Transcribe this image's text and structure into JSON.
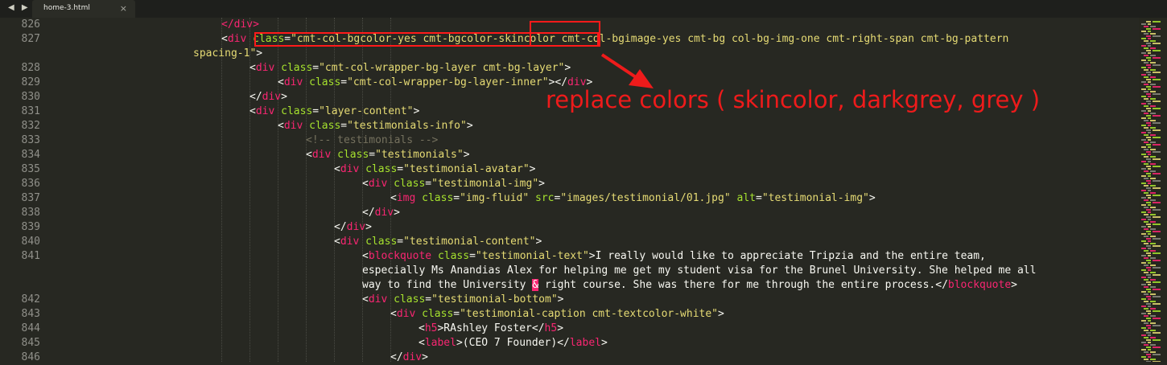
{
  "tabbar": {
    "nav": "◀ ▶",
    "tab_title": "home-3.html",
    "tab_close": "×"
  },
  "lines": [
    {
      "no": "826",
      "indent": 1,
      "segs": [
        [
          "t",
          "</div>"
        ]
      ]
    },
    {
      "no": "827",
      "indent": 1,
      "segs": [
        [
          "p",
          "<"
        ],
        [
          "t",
          "div"
        ],
        [
          "p",
          " "
        ],
        [
          "a",
          "class"
        ],
        [
          "p",
          "="
        ],
        [
          "s",
          "\"cmt-col-bgcolor-yes cmt-bgcolor-skincolor cmt-col-bgimage-yes cmt-bg col-bg-img-one cmt-right-span cmt-bg-pattern"
        ]
      ]
    },
    {
      "no": "",
      "indent": 0,
      "segs": [
        [
          "s",
          "spacing-1\""
        ],
        [
          "p",
          ">"
        ]
      ]
    },
    {
      "no": "828",
      "indent": 2,
      "segs": [
        [
          "p",
          "<"
        ],
        [
          "t",
          "div"
        ],
        [
          "p",
          " "
        ],
        [
          "a",
          "class"
        ],
        [
          "p",
          "="
        ],
        [
          "s",
          "\"cmt-col-wrapper-bg-layer cmt-bg-layer\""
        ],
        [
          "p",
          ">"
        ]
      ]
    },
    {
      "no": "829",
      "indent": 3,
      "segs": [
        [
          "p",
          "<"
        ],
        [
          "t",
          "div"
        ],
        [
          "p",
          " "
        ],
        [
          "a",
          "class"
        ],
        [
          "p",
          "="
        ],
        [
          "s",
          "\"cmt-col-wrapper-bg-layer-inner\""
        ],
        [
          "p",
          "></"
        ],
        [
          "t",
          "div"
        ],
        [
          "p",
          ">"
        ]
      ]
    },
    {
      "no": "830",
      "indent": 2,
      "segs": [
        [
          "p",
          "</"
        ],
        [
          "t",
          "div"
        ],
        [
          "p",
          ">"
        ]
      ]
    },
    {
      "no": "831",
      "indent": 2,
      "segs": [
        [
          "p",
          "<"
        ],
        [
          "t",
          "div"
        ],
        [
          "p",
          " "
        ],
        [
          "a",
          "class"
        ],
        [
          "p",
          "="
        ],
        [
          "s",
          "\"layer-content\""
        ],
        [
          "p",
          ">"
        ]
      ]
    },
    {
      "no": "832",
      "indent": 3,
      "segs": [
        [
          "p",
          "<"
        ],
        [
          "t",
          "div"
        ],
        [
          "p",
          " "
        ],
        [
          "a",
          "class"
        ],
        [
          "p",
          "="
        ],
        [
          "s",
          "\"testimonials-info\""
        ],
        [
          "p",
          ">"
        ]
      ]
    },
    {
      "no": "833",
      "indent": 4,
      "segs": [
        [
          "c",
          "<!-- testimonials -->"
        ]
      ]
    },
    {
      "no": "834",
      "indent": 4,
      "segs": [
        [
          "p",
          "<"
        ],
        [
          "t",
          "div"
        ],
        [
          "p",
          " "
        ],
        [
          "a",
          "class"
        ],
        [
          "p",
          "="
        ],
        [
          "s",
          "\"testimonials\""
        ],
        [
          "p",
          ">"
        ]
      ]
    },
    {
      "no": "835",
      "indent": 5,
      "segs": [
        [
          "p",
          "<"
        ],
        [
          "t",
          "div"
        ],
        [
          "p",
          " "
        ],
        [
          "a",
          "class"
        ],
        [
          "p",
          "="
        ],
        [
          "s",
          "\"testimonial-avatar\""
        ],
        [
          "p",
          ">"
        ]
      ]
    },
    {
      "no": "836",
      "indent": 6,
      "segs": [
        [
          "p",
          "<"
        ],
        [
          "t",
          "div"
        ],
        [
          "p",
          " "
        ],
        [
          "a",
          "class"
        ],
        [
          "p",
          "="
        ],
        [
          "s",
          "\"testimonial-img\""
        ],
        [
          "p",
          ">"
        ]
      ]
    },
    {
      "no": "837",
      "indent": 7,
      "segs": [
        [
          "p",
          "<"
        ],
        [
          "t",
          "img"
        ],
        [
          "p",
          " "
        ],
        [
          "a",
          "class"
        ],
        [
          "p",
          "="
        ],
        [
          "s",
          "\"img-fluid\""
        ],
        [
          "p",
          " "
        ],
        [
          "a",
          "src"
        ],
        [
          "p",
          "="
        ],
        [
          "s",
          "\"images/testimonial/01.jpg\""
        ],
        [
          "p",
          " "
        ],
        [
          "a",
          "alt"
        ],
        [
          "p",
          "="
        ],
        [
          "s",
          "\"testimonial-img\""
        ],
        [
          "p",
          ">"
        ]
      ]
    },
    {
      "no": "838",
      "indent": 6,
      "segs": [
        [
          "p",
          "</"
        ],
        [
          "t",
          "div"
        ],
        [
          "p",
          ">"
        ]
      ]
    },
    {
      "no": "839",
      "indent": 5,
      "segs": [
        [
          "p",
          "</"
        ],
        [
          "t",
          "div"
        ],
        [
          "p",
          ">"
        ]
      ]
    },
    {
      "no": "840",
      "indent": 5,
      "segs": [
        [
          "p",
          "<"
        ],
        [
          "t",
          "div"
        ],
        [
          "p",
          " "
        ],
        [
          "a",
          "class"
        ],
        [
          "p",
          "="
        ],
        [
          "s",
          "\"testimonial-content\""
        ],
        [
          "p",
          ">"
        ]
      ]
    },
    {
      "no": "841",
      "indent": 6,
      "segs": [
        [
          "p",
          "<"
        ],
        [
          "t",
          "blockquote"
        ],
        [
          "p",
          " "
        ],
        [
          "a",
          "class"
        ],
        [
          "p",
          "="
        ],
        [
          "s",
          "\"testimonial-text\""
        ],
        [
          "p",
          ">I really would like to appreciate Tripzia and the entire team,"
        ]
      ]
    },
    {
      "no": "",
      "indent": 6,
      "segs": [
        [
          "p",
          "especially Ms Anandias Alex for helping me get my student visa for the Brunel University. She helped me all"
        ]
      ]
    },
    {
      "no": "",
      "indent": 6,
      "segs": [
        [
          "p",
          "way to find the University "
        ],
        [
          "amp",
          "&"
        ],
        [
          "p",
          " right course. She was there for me through the entire process.</"
        ],
        [
          "t",
          "blockquote"
        ],
        [
          "p",
          ">"
        ]
      ]
    },
    {
      "no": "842",
      "indent": 6,
      "segs": [
        [
          "p",
          "<"
        ],
        [
          "t",
          "div"
        ],
        [
          "p",
          " "
        ],
        [
          "a",
          "class"
        ],
        [
          "p",
          "="
        ],
        [
          "s",
          "\"testimonial-bottom\""
        ],
        [
          "p",
          ">"
        ]
      ]
    },
    {
      "no": "843",
      "indent": 7,
      "segs": [
        [
          "p",
          "<"
        ],
        [
          "t",
          "div"
        ],
        [
          "p",
          " "
        ],
        [
          "a",
          "class"
        ],
        [
          "p",
          "="
        ],
        [
          "s",
          "\"testimonial-caption cmt-textcolor-white\""
        ],
        [
          "p",
          ">"
        ]
      ]
    },
    {
      "no": "844",
      "indent": 8,
      "segs": [
        [
          "p",
          "<"
        ],
        [
          "t",
          "h5"
        ],
        [
          "p",
          ">RAshley Foster</"
        ],
        [
          "t",
          "h5"
        ],
        [
          "p",
          ">"
        ]
      ]
    },
    {
      "no": "845",
      "indent": 8,
      "segs": [
        [
          "p",
          "<"
        ],
        [
          "t",
          "label"
        ],
        [
          "p",
          ">(CEO 7 Founder)</"
        ],
        [
          "t",
          "label"
        ],
        [
          "p",
          ">"
        ]
      ]
    },
    {
      "no": "846",
      "indent": 7,
      "segs": [
        [
          "p",
          "</"
        ],
        [
          "t",
          "div"
        ],
        [
          "p",
          ">"
        ]
      ]
    }
  ],
  "annotation": {
    "text": "replace colors ( skincolor, darkgrey, grey )",
    "color": "#ee1b1b"
  },
  "syntax_colors": {
    "tag": "#f92672",
    "attr": "#a6e22e",
    "string": "#e6db74",
    "comment": "#75715e",
    "plain": "#f8f8f2",
    "background": "#272822"
  }
}
